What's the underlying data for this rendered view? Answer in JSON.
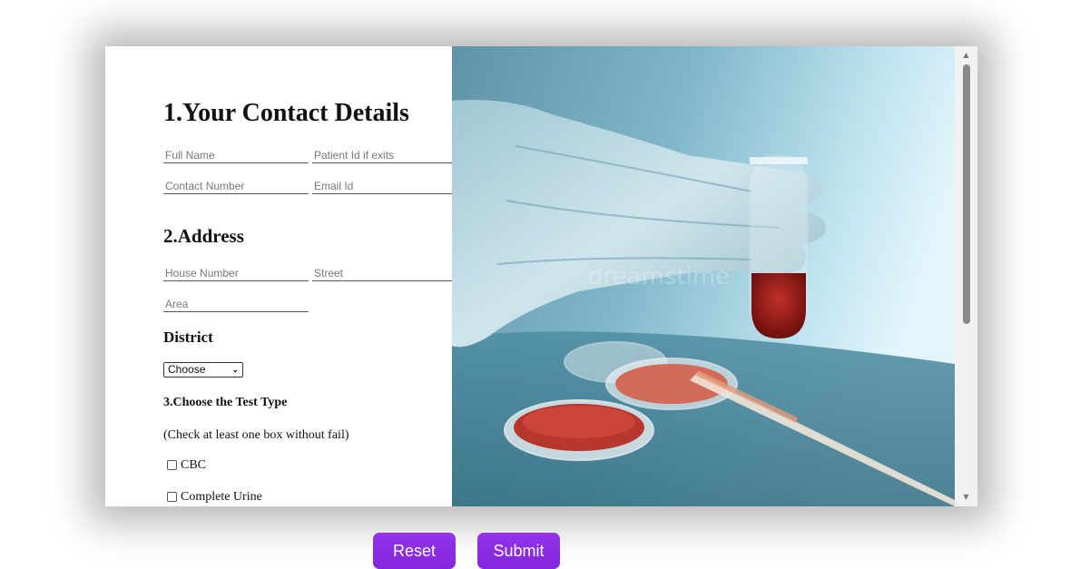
{
  "sections": {
    "contact_title": "1.Your Contact Details",
    "address_title": "2.Address",
    "district_label": "District",
    "test_type_title": "3.Choose the Test Type",
    "test_type_note": "(Check at least one box without fail)"
  },
  "fields": {
    "full_name": "Full Name",
    "patient_id": "Patient Id if exits",
    "contact_number": "Contact Number",
    "email_id": "Email Id",
    "house_number": "House Number",
    "street": "Street",
    "area": "Area"
  },
  "district_select": {
    "selected": "Choose"
  },
  "tests": [
    {
      "label": "CBC",
      "checked": false
    },
    {
      "label": "Complete Urine",
      "checked": false
    }
  ],
  "buttons": {
    "reset": "Reset",
    "submit": "Submit"
  },
  "image": {
    "watermark": "dreamstime"
  },
  "colors": {
    "button": "#8a2be2",
    "image_bg": "#8cc2d4"
  }
}
